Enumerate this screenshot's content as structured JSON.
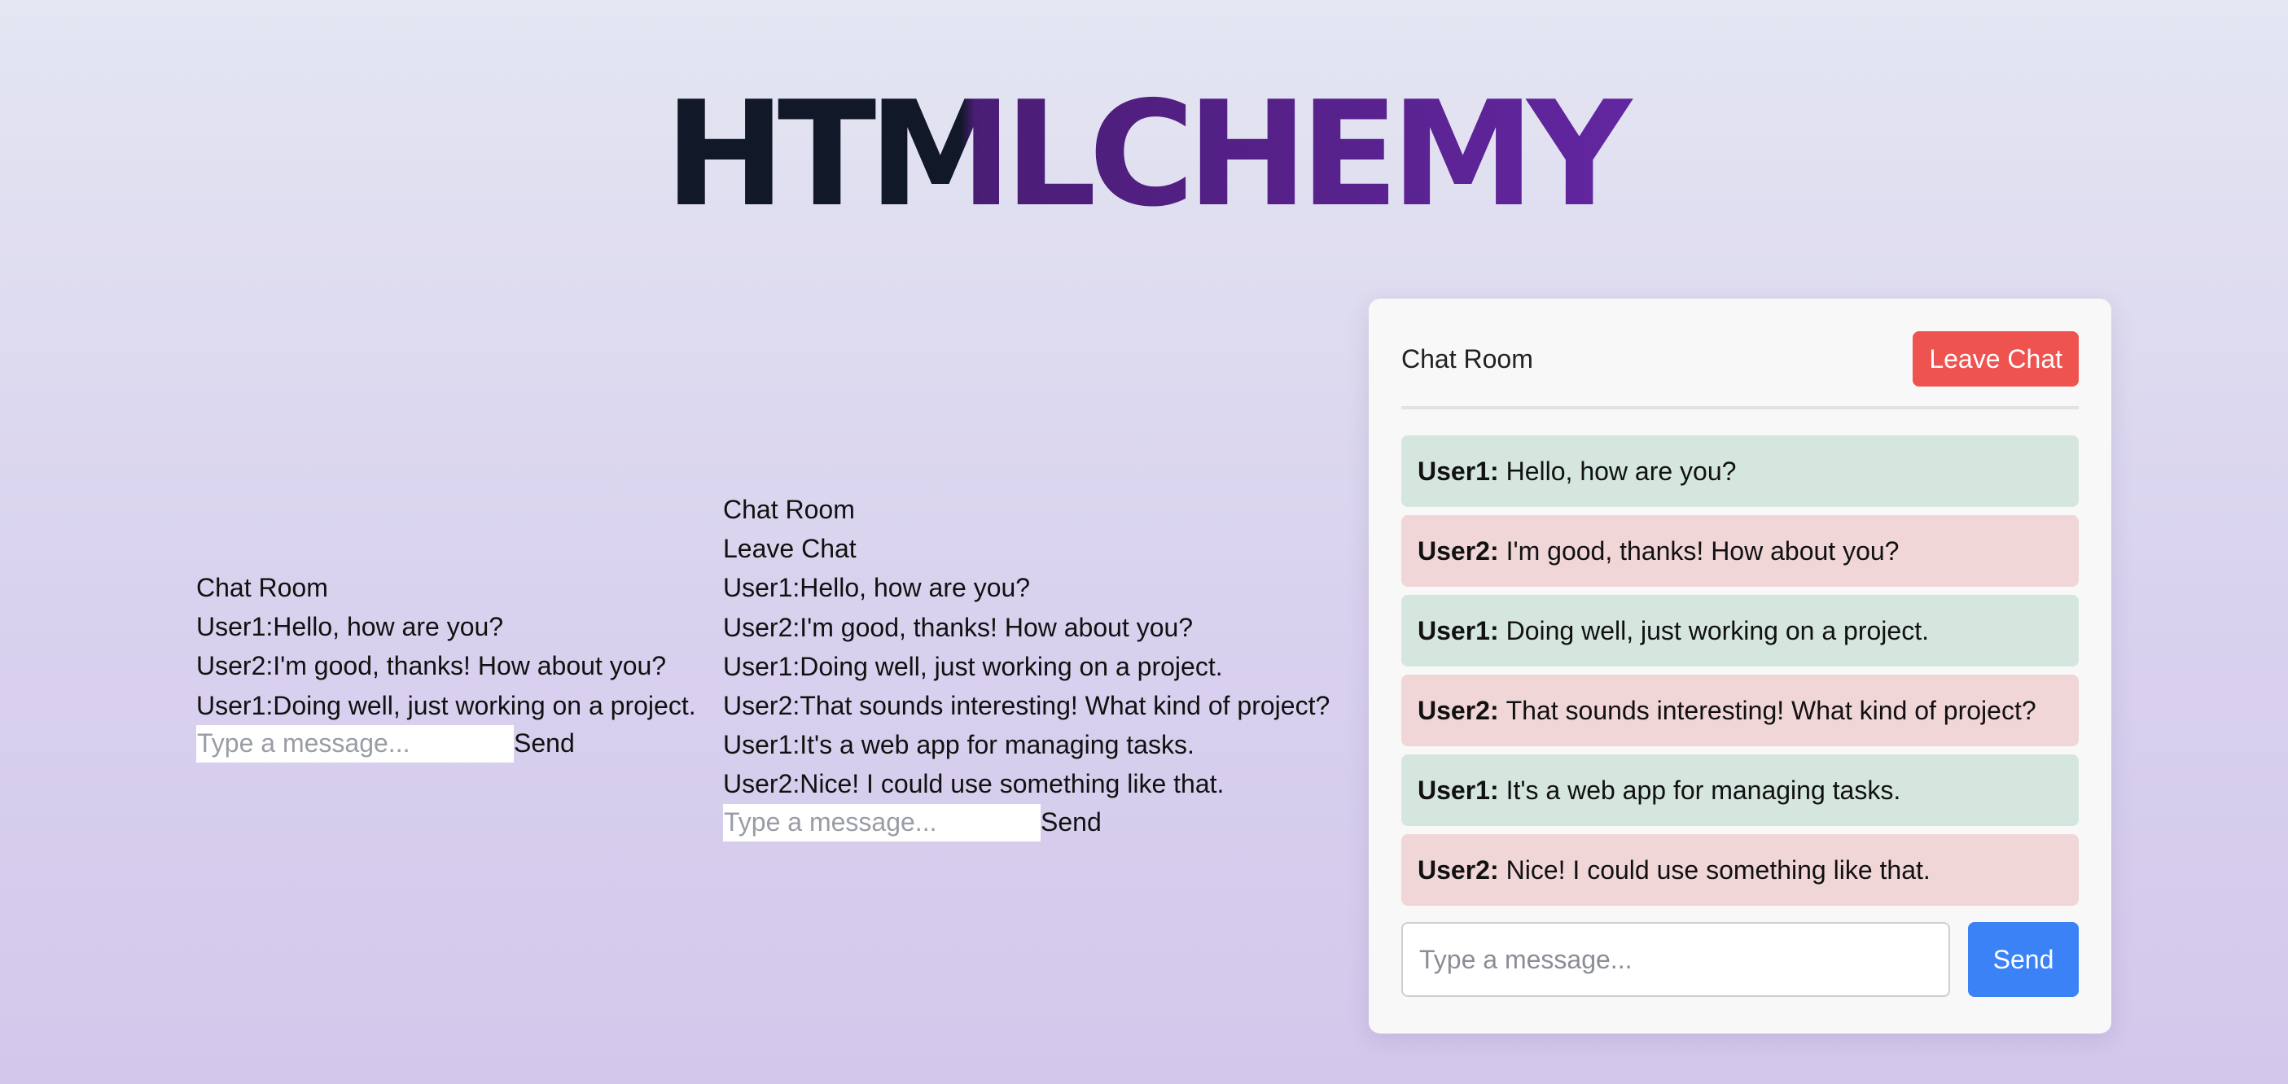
{
  "logo": {
    "text": "HTMLCHEMY"
  },
  "plain_chat_a": {
    "title": "Chat Room",
    "messages": [
      "User1:Hello, how are you?",
      "User2:I'm good, thanks! How about you?",
      "User1:Doing well, just working on a project."
    ],
    "input_placeholder": "Type a message...",
    "send_label": "Send"
  },
  "plain_chat_b": {
    "title": "Chat Room",
    "leave_label": "Leave Chat",
    "messages": [
      "User1:Hello, how are you?",
      "User2:I'm good, thanks! How about you?",
      "User1:Doing well, just working on a project.",
      "User2:That sounds interesting! What kind of project?",
      "User1:It's a web app for managing tasks.",
      "User2:Nice! I could use something like that."
    ],
    "input_placeholder": "Type a message...",
    "send_label": "Send"
  },
  "chat_card": {
    "title": "Chat Room",
    "leave_label": "Leave Chat",
    "messages": [
      {
        "sender": "User1:",
        "text": "Hello, how are you?"
      },
      {
        "sender": "User2:",
        "text": "I'm good, thanks! How about you?"
      },
      {
        "sender": "User1:",
        "text": "Doing well, just working on a project."
      },
      {
        "sender": "User2:",
        "text": "That sounds interesting! What kind of project?"
      },
      {
        "sender": "User1:",
        "text": "It's a web app for managing tasks."
      },
      {
        "sender": "User2:",
        "text": "Nice! I could use something like that."
      }
    ],
    "input_placeholder": "Type a message...",
    "send_label": "Send"
  },
  "colors": {
    "leave_button": "#ef5350",
    "send_button": "#3b82f6",
    "user1_bubble": "#d4e6de",
    "user2_bubble": "#f1d6d8",
    "logo_dark": "#111827",
    "logo_purple": "#7b2fcc"
  }
}
